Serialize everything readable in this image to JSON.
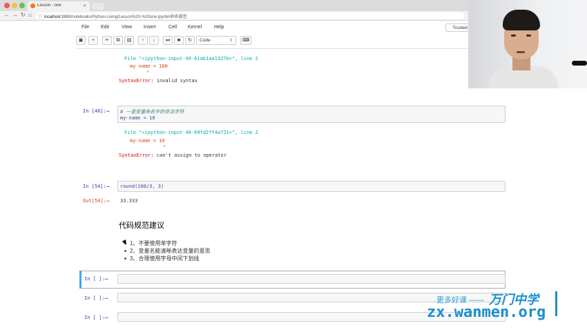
{
  "browser": {
    "tab_title": "Lesson - one",
    "url_host": "localhost",
    "url_rest": ":8888/notebooks/Python-Living/Lesson%20-%20one.ipynb#命名规范"
  },
  "menu": {
    "items": [
      "File",
      "Edit",
      "View",
      "Insert",
      "Cell",
      "Kernel",
      "Help"
    ],
    "trusted": "Trusted"
  },
  "toolbar": {
    "cell_type": "Code"
  },
  "cells": {
    "c1": {
      "tb_file": "File \"<ipython-input-49-61ab1aa1327b>\", line 2",
      "tb_code": "my name = 100",
      "tb_caret": "^",
      "err_name": "SyntaxError",
      "err_msg": ": invalid syntax"
    },
    "c2": {
      "prompt": "In [48]:⟶",
      "comment": "# 一是变量命名中的非法字符",
      "code": "my-name = 10",
      "tb_file": "File \"<ipython-input-48-69fd2ff4a721>\", line 2",
      "tb_code": "my-name = 10",
      "tb_caret": "^",
      "err_name": "SyntaxError",
      "err_msg": ": can't assign to operator"
    },
    "c3": {
      "prompt": "In [54]:⟶",
      "code": "round(100/3, 3)",
      "out_prompt": "Out[54]:⟶",
      "output": "33.333"
    },
    "md": {
      "heading": "代码规范建议",
      "items": [
        "1、不要使用单字符",
        "2、变量名能清晰表达变量的意思",
        "3、合理使用字母中间下划线"
      ]
    },
    "empty_prompt": "In [ ]:⟶"
  },
  "watermark": {
    "tagline": "更多好课 ——",
    "brand": "万门中学",
    "url": "zx.wanmen.org"
  }
}
